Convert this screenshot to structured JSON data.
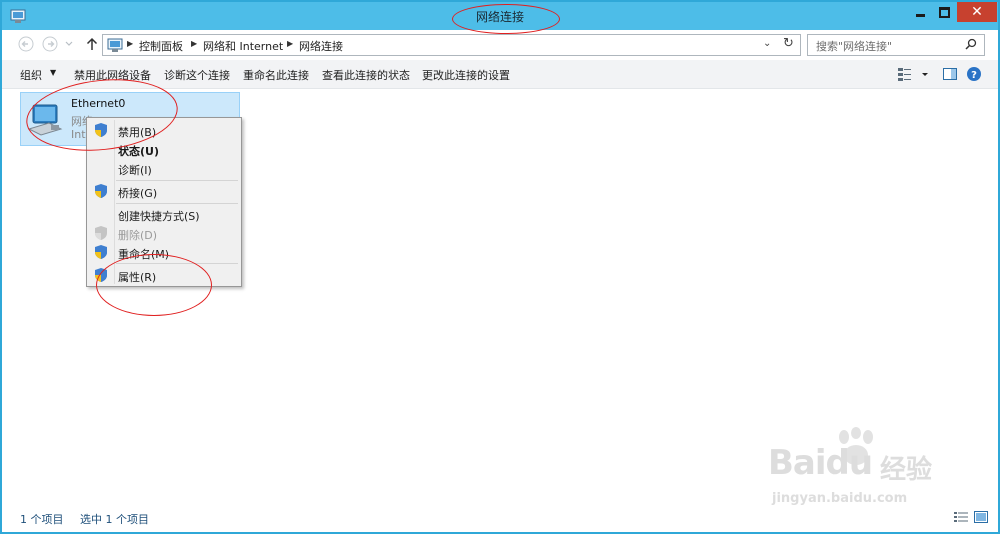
{
  "window": {
    "title": "网络连接",
    "close_label": "✕"
  },
  "address": {
    "crumbs": [
      "控制面板",
      "网络和 Internet",
      "网络连接"
    ],
    "search_placeholder": "搜索\"网络连接\""
  },
  "toolbar": {
    "organize": "组织",
    "disable": "禁用此网络设备",
    "diagnose": "诊断这个连接",
    "rename": "重命名此连接",
    "view_status": "查看此连接的状态",
    "change_settings": "更改此连接的设置"
  },
  "connection": {
    "name": "Ethernet0",
    "line2": "网络",
    "line3": "Inte"
  },
  "context_menu": {
    "items": [
      {
        "label": "禁用(B)",
        "shield": true,
        "bold": false,
        "disabled": false
      },
      {
        "label": "状态(U)",
        "shield": false,
        "bold": true,
        "disabled": false
      },
      {
        "label": "诊断(I)",
        "shield": false,
        "bold": false,
        "disabled": false
      },
      {
        "label": "桥接(G)",
        "shield": true,
        "bold": false,
        "disabled": false
      },
      {
        "label": "创建快捷方式(S)",
        "shield": false,
        "bold": false,
        "disabled": false
      },
      {
        "label": "删除(D)",
        "shield": true,
        "bold": false,
        "disabled": true
      },
      {
        "label": "重命名(M)",
        "shield": true,
        "bold": false,
        "disabled": false
      },
      {
        "label": "属性(R)",
        "shield": true,
        "bold": false,
        "disabled": false
      }
    ]
  },
  "status": {
    "count": "1 个项目",
    "selected": "选中 1 个项目"
  },
  "watermark": {
    "brand": "Baidu",
    "cn": "经验",
    "url": "jingyan.baidu.com"
  },
  "colors": {
    "titlebar": "#4dbde8",
    "close": "#c7412f",
    "selection": "#cce8fb",
    "annotation": "#e02020"
  },
  "icons": [
    "network-connections-icon",
    "back-icon",
    "forward-icon",
    "up-icon",
    "refresh-icon",
    "search-icon",
    "shield-icon",
    "view-options-icon",
    "preview-pane-icon",
    "help-icon",
    "ethernet-adapter-icon"
  ]
}
